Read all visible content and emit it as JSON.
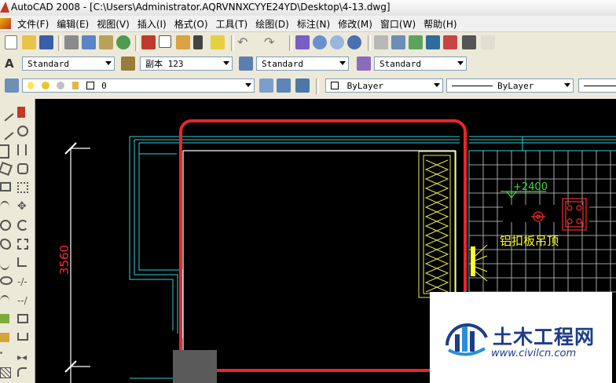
{
  "window": {
    "title": "AutoCAD 2008 - [C:\\Users\\Administrator.AQRVNNXCYYE24YD\\Desktop\\4-13.dwg]"
  },
  "menu": [
    "文件(F)",
    "编辑(E)",
    "视图(V)",
    "插入(I)",
    "格式(O)",
    "工具(T)",
    "绘图(D)",
    "标注(N)",
    "修改(M)",
    "窗口(W)",
    "帮助(H)"
  ],
  "styles_toolbar": {
    "text_style": "Standard",
    "dim_style": "副本 123",
    "table_style": "Standard",
    "multileader_style": "Standard"
  },
  "layers_toolbar": {
    "current_layer": "0",
    "color": "ByLayer",
    "linetype": "ByLayer"
  },
  "drawing": {
    "dimension_text": "3560",
    "elevation_text": "+2400",
    "ceiling_note": "铝扣板吊顶",
    "colors": {
      "background": "#000000",
      "wall": "#2fd0d8",
      "dim": "#ff2a2a",
      "annotation": "#ffff33",
      "level": "#3cd83c",
      "highlight": "#e8262b"
    }
  },
  "watermark": {
    "brand": "土木工程网",
    "url": "www.civilcn.com"
  }
}
